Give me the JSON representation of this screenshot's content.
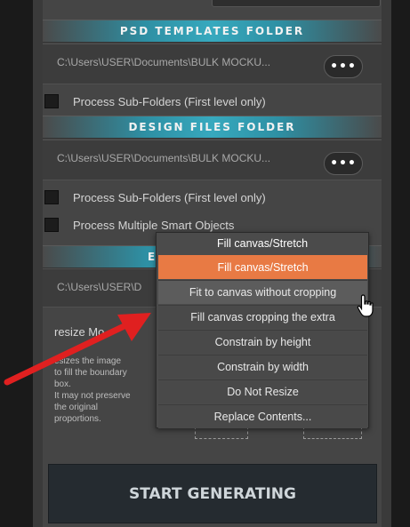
{
  "psd_templates": {
    "header": "PSD TEMPLATES FOLDER",
    "path": "C:\\Users\\USER\\Documents\\BULK MOCKU...",
    "browse": "•••",
    "subfolders_label": "Process Sub-Folders (First level only)"
  },
  "design_files": {
    "header": "DESIGN FILES FOLDER",
    "path": "C:\\Users\\USER\\Documents\\BULK MOCKU...",
    "browse": "•••",
    "subfolders_label": "Process Sub-Folders (First level only)",
    "multiple_smart_label": "Process Multiple Smart Objects"
  },
  "export": {
    "header_fragment": "E",
    "path_fragment": "C:\\Users\\USER\\D"
  },
  "resize": {
    "label": "resize Mo",
    "desc_lines": [
      "esizes the image",
      "to fill the boundary",
      "box.",
      "It may not preserve",
      "the original",
      "proportions."
    ]
  },
  "dropdown": {
    "current": "Fill canvas/Stretch",
    "options": [
      "Fill canvas/Stretch",
      "Fit to canvas without cropping",
      "Fill canvas cropping the extra",
      "Constrain by height",
      "Constrain by width",
      "Do Not Resize",
      "Replace Contents..."
    ],
    "selected_index": 0,
    "hover_index": 1
  },
  "start_button": "START GENERATING",
  "colors": {
    "accent_selected": "#e87a44",
    "header_teal": "#37a9be",
    "arrow": "#e02020"
  }
}
